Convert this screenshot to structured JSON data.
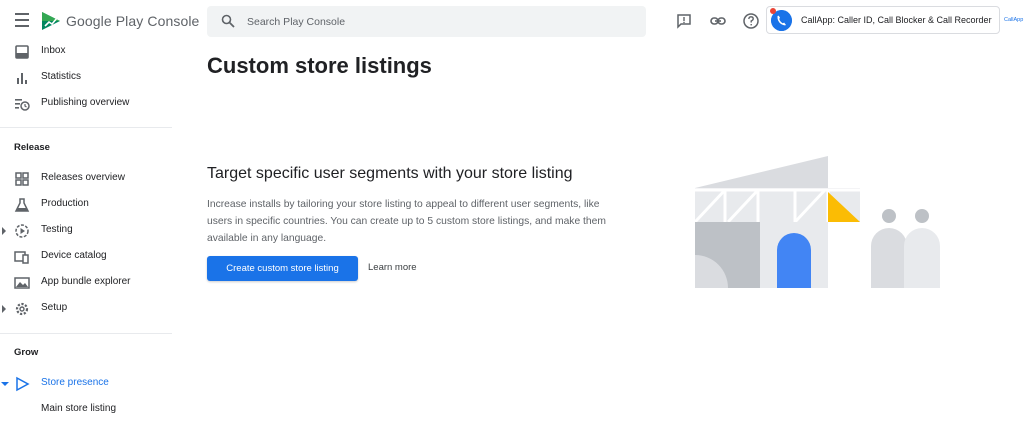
{
  "brand": {
    "name": "Google Play Console"
  },
  "sidebar": {
    "top_items": [
      {
        "label": "Inbox",
        "icon": "inbox-icon"
      },
      {
        "label": "Statistics",
        "icon": "bar-chart-icon"
      },
      {
        "label": "Publishing overview",
        "icon": "publishing-overview-icon"
      }
    ],
    "release": {
      "heading": "Release",
      "items": [
        {
          "label": "Releases overview",
          "icon": "grid-icon"
        },
        {
          "label": "Production",
          "icon": "flask-icon"
        },
        {
          "label": "Testing",
          "icon": "play-circle-icon"
        },
        {
          "label": "Device catalog",
          "icon": "devices-icon"
        },
        {
          "label": "App bundle explorer",
          "icon": "image-icon"
        },
        {
          "label": "Setup",
          "icon": "gear-icon"
        }
      ]
    },
    "grow": {
      "heading": "Grow",
      "items": [
        {
          "label": "Store presence",
          "icon": "play-icon"
        },
        {
          "label": "Main store listing"
        }
      ]
    }
  },
  "search": {
    "placeholder": "Search Play Console"
  },
  "topbar": {
    "app_name": "CallApp: Caller ID, Call Blocker & Call Recorder",
    "avatar_text": "CallApp"
  },
  "main": {
    "title": "Custom store listings",
    "subtitle": "Target specific user segments with your store listing",
    "description": "Increase installs by tailoring your store listing to appeal to different user segments, like users in specific countries. You can create up to 5 custom store listings, and make them available in any language.",
    "cta_label": "Create custom store listing",
    "learn_more": "Learn more"
  },
  "colors": {
    "accent": "#1a73e8",
    "illustration_gray": "#dadce0",
    "illustration_dark": "#bdc1c6",
    "illustration_yellow": "#fbbc04"
  }
}
